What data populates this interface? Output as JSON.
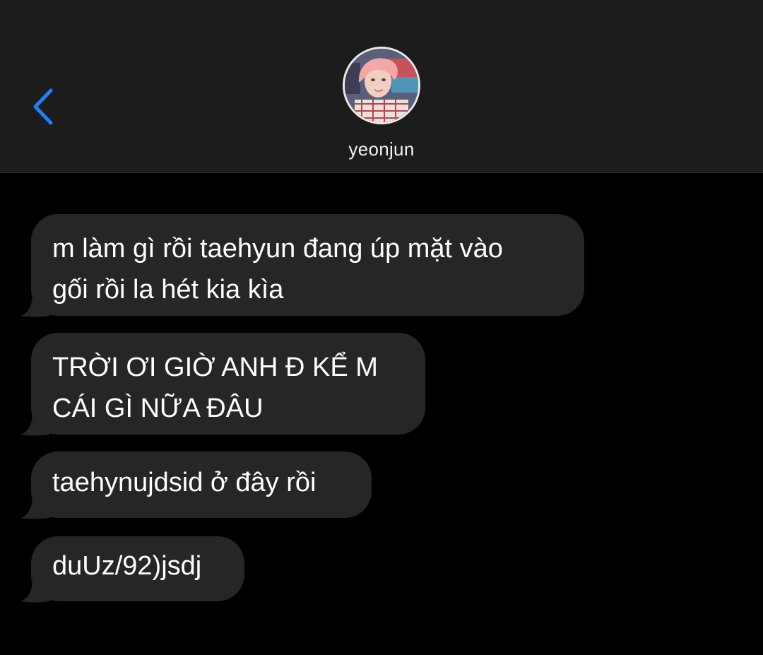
{
  "header": {
    "contact_name": "yeonjun",
    "back_icon": "chevron-left-icon",
    "accent_color": "#1a82fb"
  },
  "messages": [
    {
      "lines": [
        "m làm gì rồi taehyun đang úp mặt vào",
        "gối rồi la hét kia kìa"
      ]
    },
    {
      "lines": [
        "TRỜI ƠI GIỜ ANH Đ KỂ M",
        "CÁI GÌ NỮA ĐÂU"
      ]
    },
    {
      "lines": [
        "taehynujdsid ở đây rồi"
      ]
    },
    {
      "lines": [
        "duUz/92)jsdj"
      ]
    }
  ],
  "colors": {
    "background": "#000000",
    "header_background": "#1c1c1c",
    "bubble_background": "#262628",
    "text": "#ffffff"
  }
}
